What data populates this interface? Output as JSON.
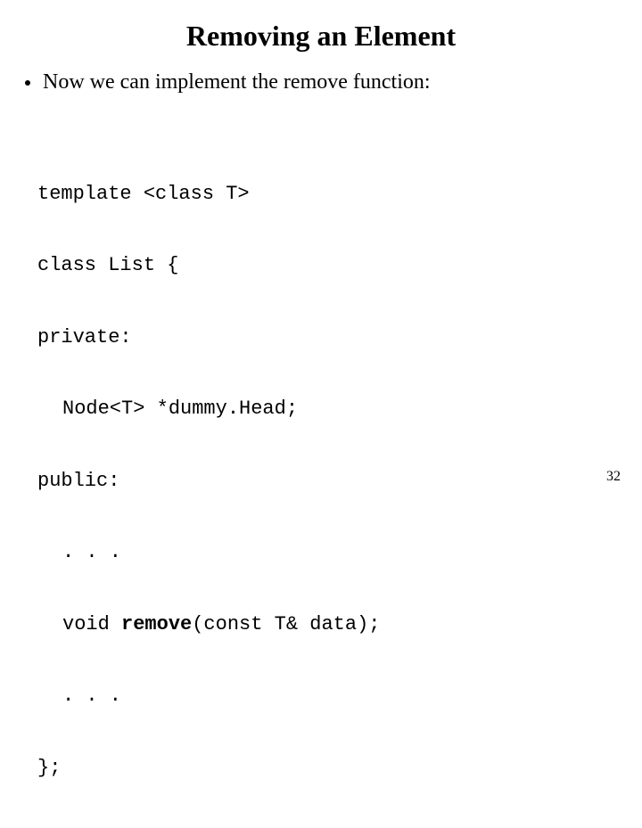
{
  "title": "Removing an Element",
  "bullet": "Now we can implement the remove function:",
  "code": {
    "l1": "template <class T>",
    "l2": "class List {",
    "l3": "private:",
    "l4": "Node<T> *dummy.Head;",
    "l5": "public:",
    "l6": ". . .",
    "l7a": "void ",
    "l7b": "remove",
    "l7c": "(const T& data);",
    "l8": ". . .",
    "l9": "};"
  },
  "page_number": "32"
}
